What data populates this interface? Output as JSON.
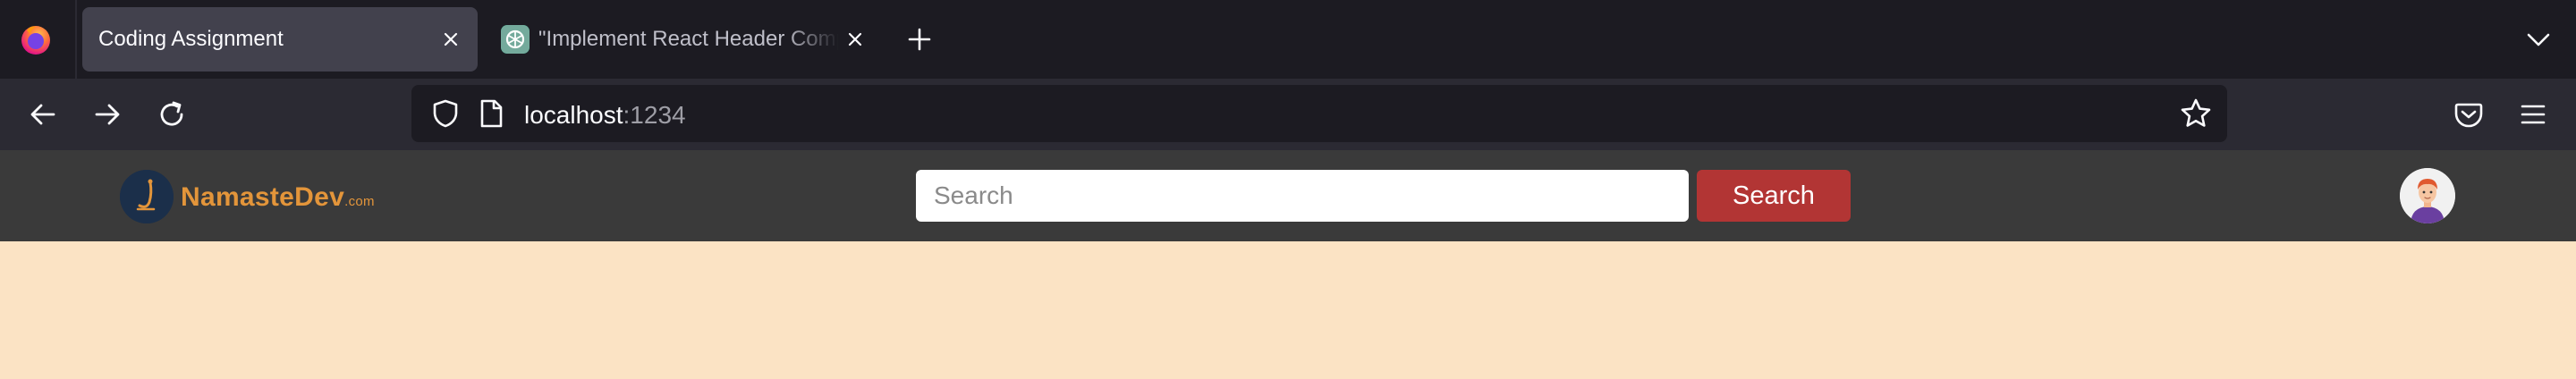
{
  "browser": {
    "tabs": [
      {
        "title": "Coding Assignment",
        "active": true
      },
      {
        "title": "\"Implement React Header Component\"",
        "active": false
      }
    ],
    "address_bar": {
      "host": "localhost",
      "port": ":1234"
    }
  },
  "app": {
    "logo": {
      "name": "NamasteDev",
      "domain": ".com"
    },
    "search": {
      "placeholder": "Search",
      "button_label": "Search"
    }
  },
  "colors": {
    "header_bg": "#3a3a3a",
    "page_bg": "#fbe3c4",
    "search_button": "#b23534",
    "logo_text": "#e3953a"
  },
  "icons": {
    "browser": "firefox-icon",
    "tab_favicon": "openai-icon",
    "nav": [
      "back-arrow-icon",
      "forward-arrow-icon",
      "reload-icon"
    ],
    "url": [
      "shield-icon",
      "page-icon",
      "star-icon"
    ],
    "toolbar": [
      "pocket-icon",
      "menu-icon"
    ]
  }
}
